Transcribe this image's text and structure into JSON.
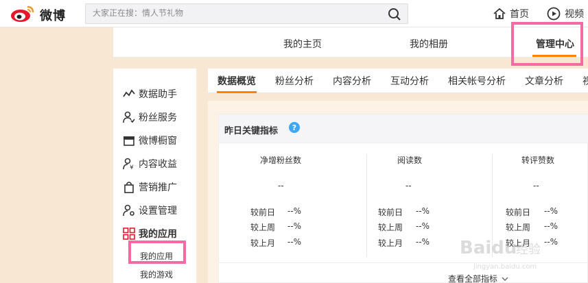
{
  "topbar": {
    "logo_text": "微博",
    "search_placeholder": "大家正在搜：情人节礼物",
    "home_label": "首页",
    "video_label": "视频"
  },
  "subnav": {
    "items": [
      "我的主页",
      "我的相册",
      "管理中心"
    ],
    "active": "管理中心"
  },
  "sidebar": {
    "items": [
      {
        "label": "数据助手",
        "icon": "chart-line-icon"
      },
      {
        "label": "粉丝服务",
        "icon": "fans-icon"
      },
      {
        "label": "微博橱窗",
        "icon": "shop-icon"
      },
      {
        "label": "内容收益",
        "icon": "income-icon"
      },
      {
        "label": "营销推广",
        "icon": "bag-icon"
      },
      {
        "label": "设置管理",
        "icon": "settings-user-icon"
      },
      {
        "label": "我的应用",
        "icon": "apps-grid-icon"
      }
    ],
    "sub_items": [
      "我的应用",
      "我的游戏"
    ]
  },
  "tabs": [
    "数据概览",
    "粉丝分析",
    "内容分析",
    "互动分析",
    "相关帐号分析",
    "文章分析",
    "视"
  ],
  "panel": {
    "title": "昨日关键指标",
    "metrics": [
      {
        "title": "净增粉丝数",
        "value": "--",
        "day": "--%",
        "week": "--%",
        "month": "--%"
      },
      {
        "title": "阅读数",
        "value": "--",
        "day": "--%",
        "week": "--%",
        "month": "--%"
      },
      {
        "title": "转评赞数",
        "value": "--",
        "day": "--%",
        "week": "--%",
        "month": "--%"
      }
    ],
    "cmp_labels": [
      "较前日",
      "较上周",
      "较上月"
    ],
    "view_all": "查看全部指标"
  },
  "watermark": {
    "text": "Baidu 经验",
    "url_text": "jingyan.baidu.com"
  },
  "colors": {
    "accent": "#ff8200",
    "highlight": "#f46aa3",
    "page_bg": "#f8e8d3",
    "help": "#3ea8f5"
  }
}
